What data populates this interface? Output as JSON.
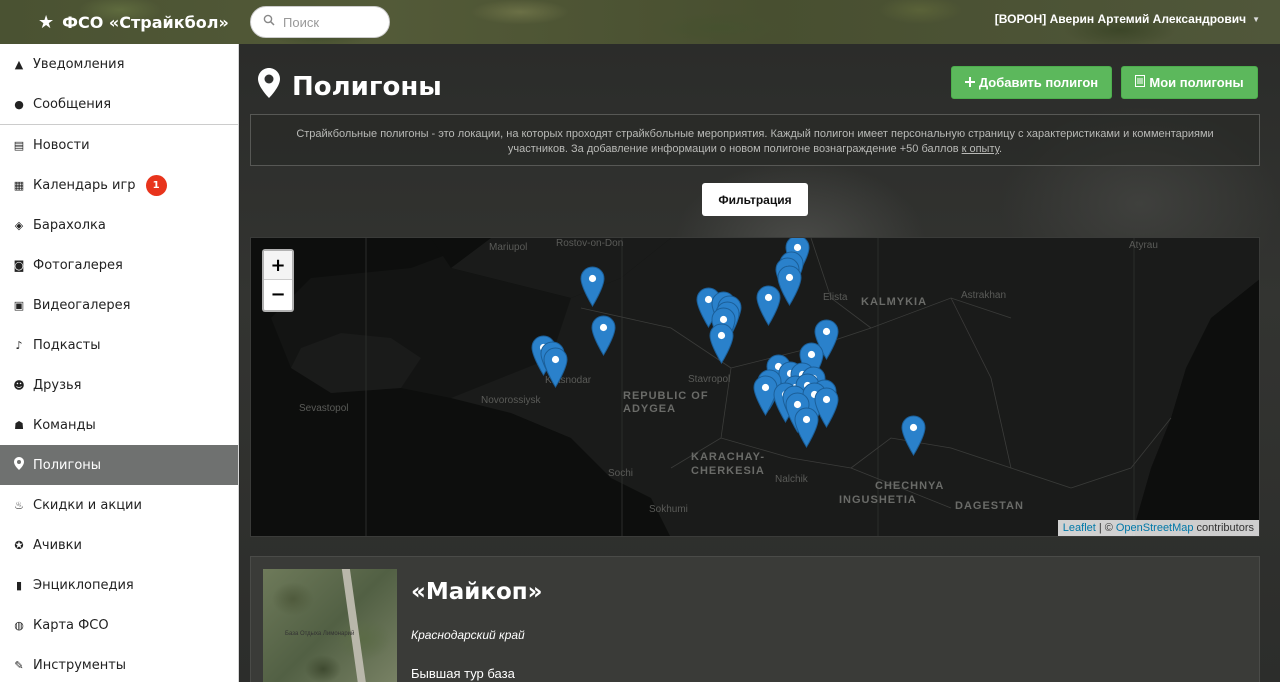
{
  "header": {
    "brand": "ФСО «Страйкбол»",
    "search_placeholder": "Поиск",
    "user_name": "[ВОРОН] Аверин Артемий Александрович"
  },
  "sidebar": {
    "groups": [
      [
        {
          "label": "Уведомления",
          "icon": "warning-icon"
        },
        {
          "label": "Сообщения",
          "icon": "chat-bubble-icon"
        }
      ],
      [
        {
          "label": "Новости",
          "icon": "newspaper-icon"
        },
        {
          "label": "Календарь игр",
          "icon": "calendar-icon",
          "badge": "1"
        },
        {
          "label": "Барахолка",
          "icon": "tag-icon"
        },
        {
          "label": "Фотогалерея",
          "icon": "camera-icon"
        },
        {
          "label": "Видеогалерея",
          "icon": "film-icon"
        },
        {
          "label": "Подкасты",
          "icon": "microphone-icon"
        },
        {
          "label": "Друзья",
          "icon": "users-icon"
        },
        {
          "label": "Команды",
          "icon": "team-icon"
        },
        {
          "label": "Полигоны",
          "icon": "map-marker-icon",
          "active": true
        },
        {
          "label": "Скидки и акции",
          "icon": "fire-icon"
        },
        {
          "label": "Ачивки",
          "icon": "star-circle-icon"
        },
        {
          "label": "Энциклопедия",
          "icon": "book-icon"
        },
        {
          "label": "Карта ФСО",
          "icon": "globe-icon"
        },
        {
          "label": "Инструменты",
          "icon": "wrench-icon"
        }
      ]
    ]
  },
  "main": {
    "title": "Полигоны",
    "add_button": "Добавить полигон",
    "my_button": "Мои полигоны",
    "info_text": "Страйкбольные полигоны - это локации, на которых проходят страйкбольные мероприятия. Каждый полигон имеет персональную страницу с характеристиками и комментариями участников. За добавление информации о новом полигоне вознаграждение +50 баллов ",
    "info_link": "к опыту",
    "info_end": ".",
    "filter_button": "Фильтрация"
  },
  "map": {
    "zoom_in": "+",
    "zoom_out": "−",
    "labels": {
      "mariupol": "Mariupol",
      "rostov": "Rostov-on-Don",
      "elista": "Elista",
      "kalmykia": "KALMYKIA",
      "astrakhan": "Astrakhan",
      "atyrau": "Atyrau",
      "sevastopol": "Sevastopol",
      "novorossiysk": "Novorossiysk",
      "krasnodar": "Krasnodar",
      "adygea": "REPUBLIC OF ADYGEA",
      "stavropol": "Stavropol",
      "karachay": "KARACHAY-CHERKESIA",
      "sochi": "Sochi",
      "sokhumi": "Sokhumi",
      "nalchik": "Nalchik",
      "chechnya": "CHECHNYA",
      "ingushetia": "INGUSHETIA",
      "dagestan": "DAGESTAN"
    },
    "attribution_leaflet": "Leaflet",
    "attribution_sep": "| ©",
    "attribution_osm": "OpenStreetMap",
    "attribution_tail": "contributors",
    "marker_color": "#2a81cb"
  },
  "card": {
    "title": "«Майкоп»",
    "region": "Краснодарский край",
    "description": "Бывшая тур база",
    "image_caption": "База Отдыха Лимонарий"
  }
}
